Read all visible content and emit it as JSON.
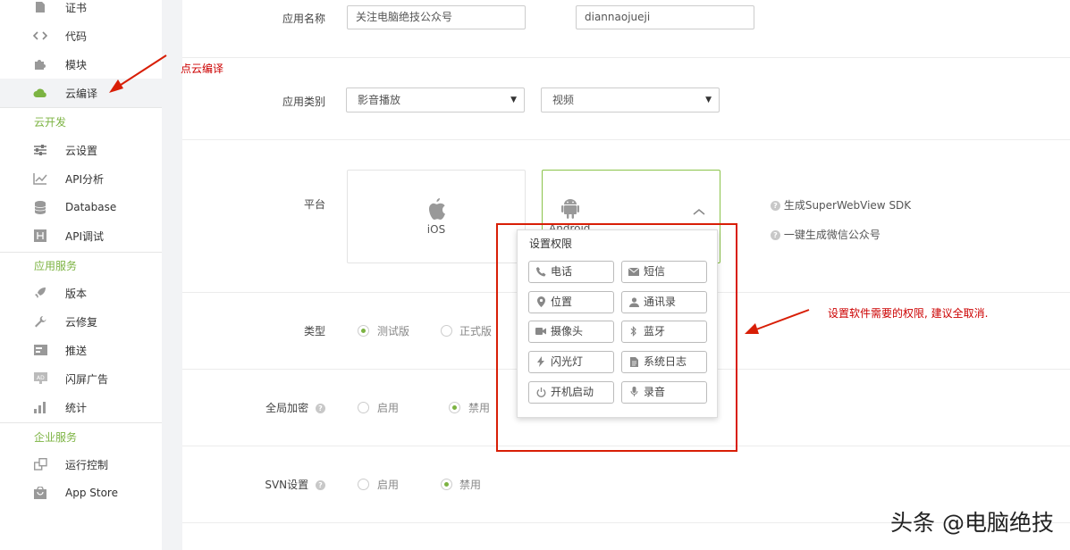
{
  "sidebar": {
    "items_top": [
      {
        "label": "证书",
        "icon": "certificate-icon"
      },
      {
        "label": "代码",
        "icon": "code-icon"
      },
      {
        "label": "模块",
        "icon": "puzzle-icon"
      },
      {
        "label": "云编译",
        "icon": "cloud-icon",
        "active": true
      }
    ],
    "section_cloud": "云开发",
    "items_cloud": [
      {
        "label": "云设置",
        "icon": "sliders-icon"
      },
      {
        "label": "API分析",
        "icon": "chart-line-icon"
      },
      {
        "label": "Database",
        "icon": "database-icon"
      },
      {
        "label": "API调试",
        "icon": "debug-icon"
      }
    ],
    "section_app": "应用服务",
    "items_app": [
      {
        "label": "版本",
        "icon": "rocket-icon"
      },
      {
        "label": "云修复",
        "icon": "wrench-icon"
      },
      {
        "label": "推送",
        "icon": "push-icon"
      },
      {
        "label": "闪屏广告",
        "icon": "ad-icon"
      },
      {
        "label": "统计",
        "icon": "bar-chart-icon"
      }
    ],
    "section_enterprise": "企业服务",
    "items_enterprise": [
      {
        "label": "运行控制",
        "icon": "control-icon"
      },
      {
        "label": "App Store",
        "icon": "bag-icon"
      }
    ]
  },
  "form": {
    "app_name_label": "应用名称",
    "app_name_value": "关注电脑绝技公众号",
    "app_id_value": "diannaojueji",
    "app_type_label": "应用类别",
    "app_type_primary": "影音播放",
    "app_type_secondary": "视频",
    "platform_label": "平台",
    "platform_ios": "iOS",
    "platform_android": "Android",
    "sdk_link": "生成SuperWebView SDK",
    "wechat_link": "一键生成微信公众号",
    "build_type_label": "类型",
    "build_type_test": "测试版",
    "build_type_release": "正式版",
    "encrypt_label": "全局加密",
    "encrypt_on": "启用",
    "encrypt_off": "禁用",
    "svn_label": "SVN设置",
    "svn_on": "启用",
    "svn_off": "禁用"
  },
  "permissions": {
    "title": "设置权限",
    "items": [
      {
        "label": "电话",
        "icon": "phone-icon"
      },
      {
        "label": "短信",
        "icon": "envelope-icon"
      },
      {
        "label": "位置",
        "icon": "location-pin-icon"
      },
      {
        "label": "通讯录",
        "icon": "contacts-icon"
      },
      {
        "label": "摄像头",
        "icon": "camera-icon"
      },
      {
        "label": "蓝牙",
        "icon": "bluetooth-icon"
      },
      {
        "label": "闪光灯",
        "icon": "flash-icon"
      },
      {
        "label": "系统日志",
        "icon": "log-file-icon"
      },
      {
        "label": "开机启动",
        "icon": "power-icon"
      },
      {
        "label": "录音",
        "icon": "microphone-icon"
      }
    ]
  },
  "annotations": {
    "cloud_compile_hint": "点云编译",
    "permission_hint": "设置软件需要的权限, 建议全取消."
  },
  "watermark": "头条 @电脑绝技",
  "colors": {
    "accent": "#7cb342",
    "annotation_red": "#d81e06",
    "icon_gray": "#8a8a8a"
  }
}
